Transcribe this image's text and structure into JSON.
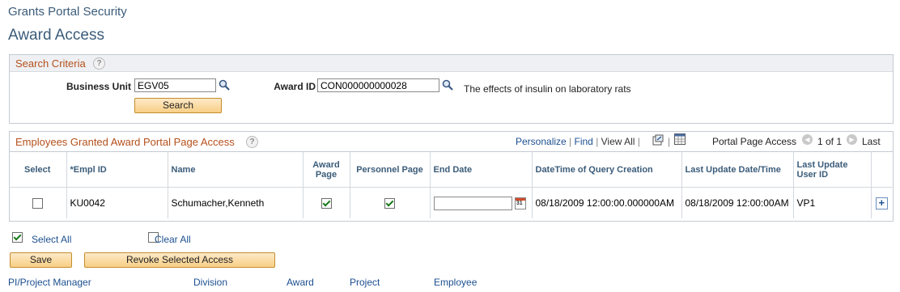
{
  "breadcrumb": "Grants Portal Security",
  "page_title": "Award Access",
  "search": {
    "title": "Search Criteria",
    "help": "?",
    "business_unit_label": "Business Unit",
    "business_unit_value": "EGV05",
    "award_id_label": "Award ID",
    "award_id_value": "CON000000000028",
    "award_description": "The effects of insulin on laboratory rats",
    "search_button": "Search"
  },
  "grid": {
    "title": "Employees Granted Award Portal Page Access",
    "help": "?",
    "toolbar": {
      "personalize": "Personalize",
      "find": "Find",
      "view_all": "View All",
      "portal_label": "Portal Page Access",
      "range": "1 of 1",
      "last": "Last"
    },
    "columns": {
      "select": "Select",
      "empl_id": "*Empl ID",
      "name": "Name",
      "award_page": "Award Page",
      "personnel_page": "Personnel Page",
      "end_date": "End Date",
      "datetime_query": "DateTime of Query Creation",
      "last_update_datetime": "Last Update Date/Time",
      "last_update_user": "Last Update User ID"
    },
    "rows": [
      {
        "select": false,
        "empl_id": "KU0042",
        "name": "Schumacher,Kenneth",
        "award_page": true,
        "personnel_page": true,
        "end_date": "",
        "datetime_query": "08/18/2009 12:00:00.000000AM",
        "last_update_datetime": "08/18/2009 12:00:00AM",
        "last_update_user": "VP1"
      }
    ]
  },
  "actions": {
    "select_all": "Select All",
    "clear_all": "Clear All",
    "save": "Save",
    "revoke": "Revoke Selected Access"
  },
  "footer_links": [
    "PI/Project Manager",
    "Division",
    "Award",
    "Project",
    "Employee"
  ],
  "icons": {
    "lookup": "magnifier-icon",
    "calendar": "calendar-icon",
    "zoom": "zoom-icon",
    "download": "download-icon",
    "prev": "prev-icon",
    "next": "next-icon",
    "add_row": "add-row-icon"
  }
}
